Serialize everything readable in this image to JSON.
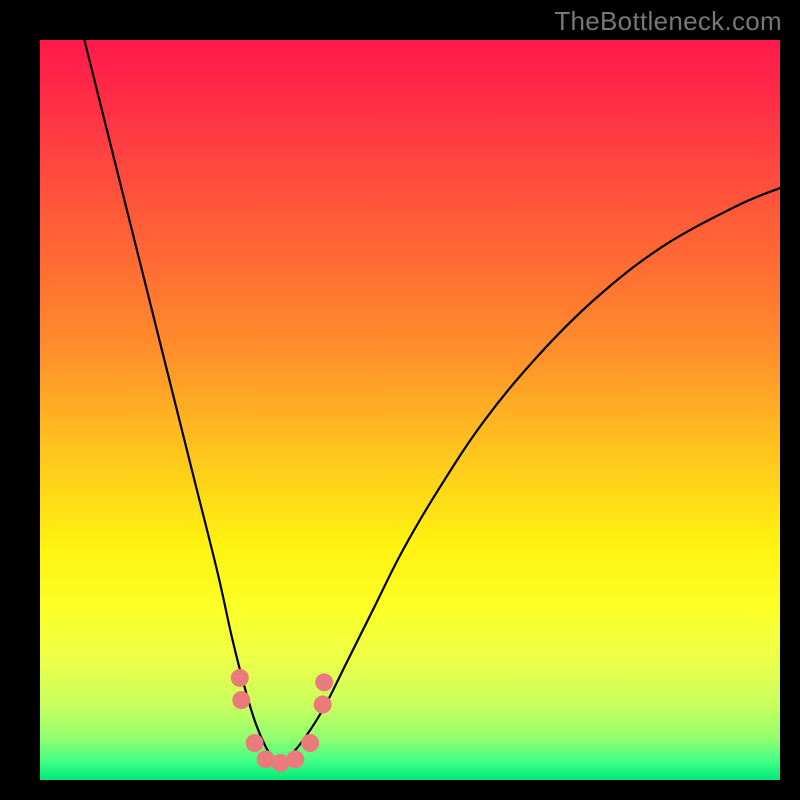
{
  "watermark": "TheBottleneck.com",
  "colors": {
    "frame_bg": "#000000",
    "curve_stroke": "#000000",
    "marker_fill": "#eb7a7c",
    "gradient_stops": [
      {
        "offset": 0.0,
        "color": "#ff1a4c"
      },
      {
        "offset": 0.07,
        "color": "#ff2a47"
      },
      {
        "offset": 0.18,
        "color": "#ff4a3e"
      },
      {
        "offset": 0.3,
        "color": "#ff6b33"
      },
      {
        "offset": 0.42,
        "color": "#ff8f2b"
      },
      {
        "offset": 0.55,
        "color": "#ffc21e"
      },
      {
        "offset": 0.68,
        "color": "#fff210"
      },
      {
        "offset": 0.77,
        "color": "#fbff26"
      },
      {
        "offset": 0.84,
        "color": "#ebff4a"
      },
      {
        "offset": 0.9,
        "color": "#c8ff5e"
      },
      {
        "offset": 0.945,
        "color": "#8fff70"
      },
      {
        "offset": 0.975,
        "color": "#3fff86"
      },
      {
        "offset": 1.0,
        "color": "#00e87a"
      }
    ]
  },
  "chart_data": {
    "type": "line",
    "title": "",
    "xlabel": "",
    "ylabel": "",
    "xlim": [
      0,
      1
    ],
    "ylim": [
      0,
      1
    ],
    "note": "x and y normalized to plot area (0,0 = top-left). Two branches of a V-shaped curve with minimum near x≈0.31, y≈0.975. Right branch asymptotes toward top-right.",
    "series": [
      {
        "name": "left-branch",
        "x": [
          0.06,
          0.09,
          0.12,
          0.15,
          0.18,
          0.21,
          0.24,
          0.26,
          0.278,
          0.292,
          0.305,
          0.315,
          0.325
        ],
        "values": [
          0.0,
          0.12,
          0.24,
          0.36,
          0.48,
          0.6,
          0.72,
          0.81,
          0.88,
          0.925,
          0.955,
          0.97,
          0.976
        ]
      },
      {
        "name": "right-branch",
        "x": [
          0.325,
          0.34,
          0.36,
          0.385,
          0.415,
          0.45,
          0.49,
          0.54,
          0.6,
          0.67,
          0.75,
          0.84,
          0.94,
          1.0
        ],
        "values": [
          0.976,
          0.965,
          0.94,
          0.9,
          0.84,
          0.77,
          0.69,
          0.605,
          0.515,
          0.43,
          0.35,
          0.28,
          0.225,
          0.2
        ]
      }
    ],
    "markers": {
      "name": "highlight-dots",
      "x": [
        0.27,
        0.272,
        0.29,
        0.305,
        0.325,
        0.345,
        0.365,
        0.382,
        0.384
      ],
      "values": [
        0.862,
        0.892,
        0.95,
        0.972,
        0.977,
        0.972,
        0.95,
        0.898,
        0.868
      ],
      "r": 9
    }
  }
}
